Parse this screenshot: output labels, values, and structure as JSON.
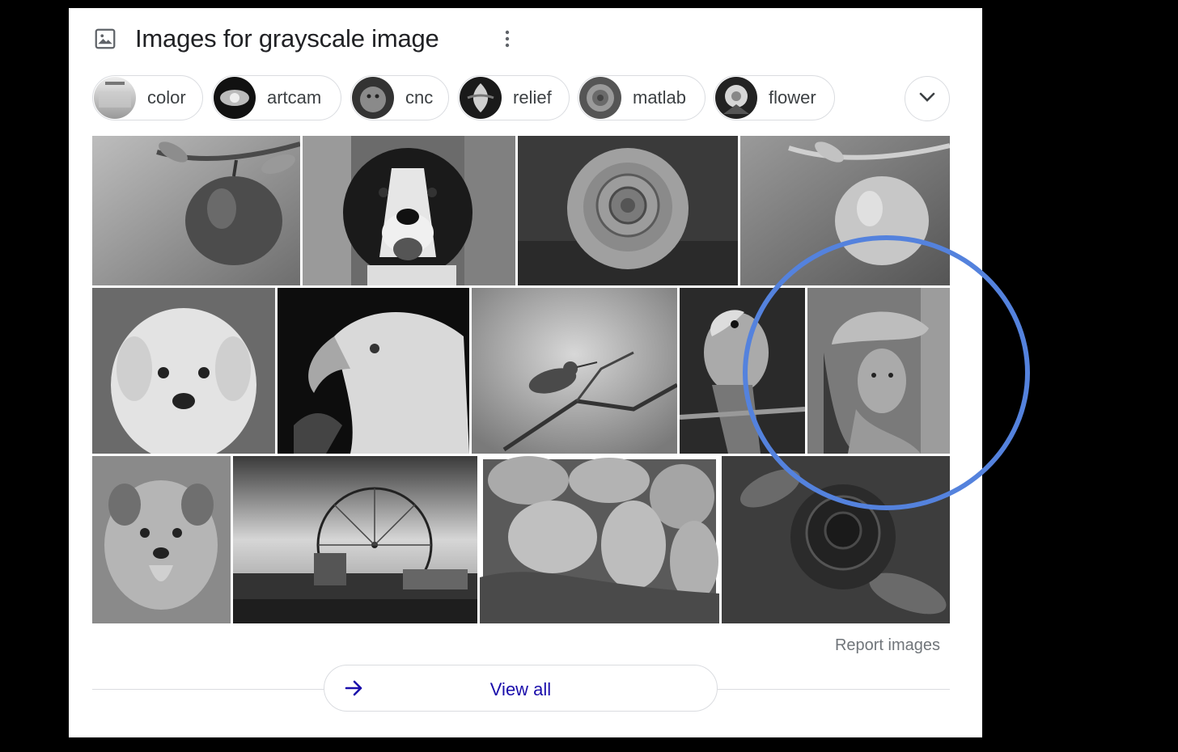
{
  "header": {
    "title": "Images for grayscale image",
    "icon": "image-icon",
    "menu_icon": "more-vert-icon"
  },
  "chips": [
    {
      "label": "color"
    },
    {
      "label": "artcam"
    },
    {
      "label": "cnc"
    },
    {
      "label": "relief"
    },
    {
      "label": "matlab"
    },
    {
      "label": "flower"
    }
  ],
  "expand_icon": "chevron-down-icon",
  "images": [
    {
      "subject": "apple"
    },
    {
      "subject": "dog"
    },
    {
      "subject": "rose"
    },
    {
      "subject": "apple"
    },
    {
      "subject": "puppy"
    },
    {
      "subject": "eagle"
    },
    {
      "subject": "bird"
    },
    {
      "subject": "parrot"
    },
    {
      "subject": "woman-in-hat"
    },
    {
      "subject": "dog"
    },
    {
      "subject": "ferris-wheel"
    },
    {
      "subject": "potatoes"
    },
    {
      "subject": "rose"
    }
  ],
  "report_label": "Report images",
  "view_all": {
    "label": "View all",
    "icon": "arrow-right-icon"
  },
  "colors": {
    "highlight_circle": "#5482dd",
    "link": "#1a0dab"
  }
}
